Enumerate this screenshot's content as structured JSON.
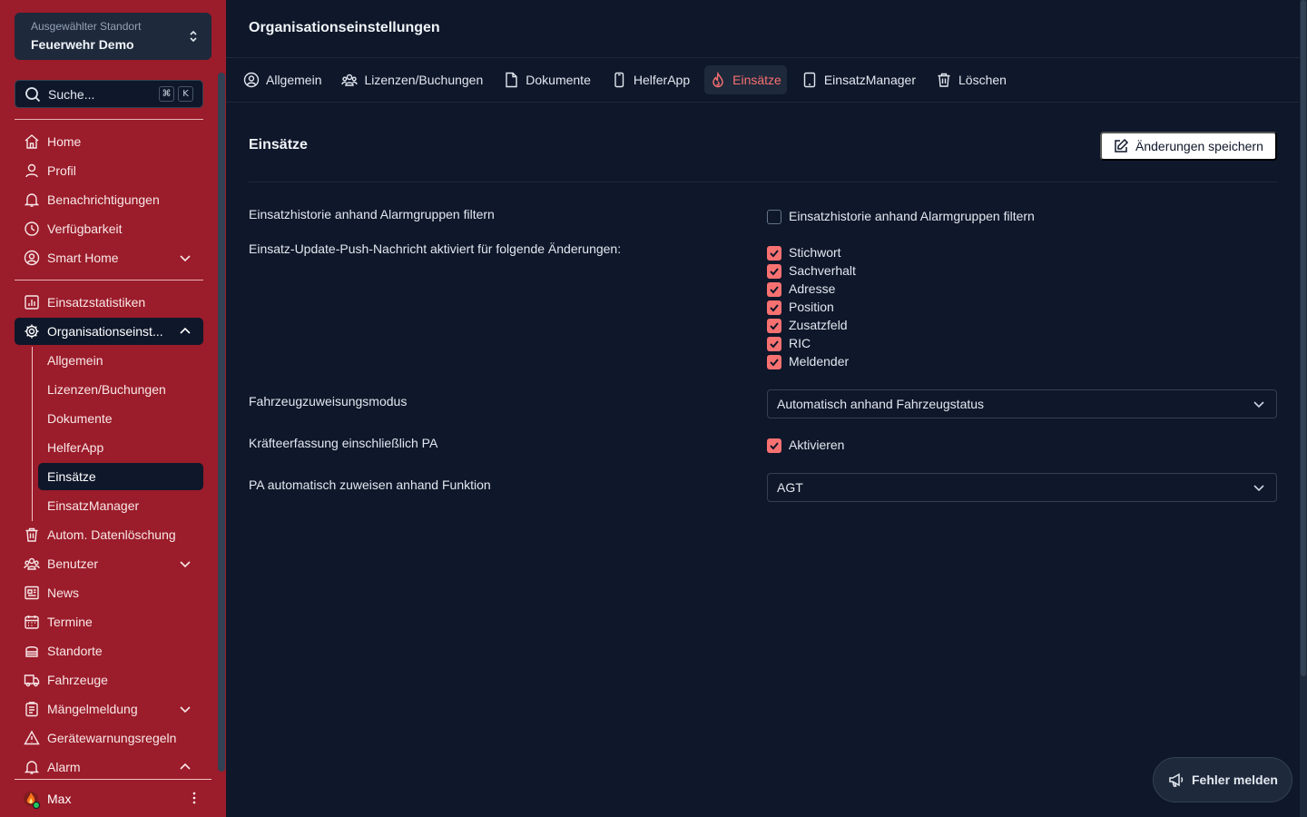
{
  "sidebar": {
    "location_label": "Ausgewählter Standort",
    "location_value": "Feuerwehr Demo",
    "search_label": "Suche...",
    "search_kbd_1": "⌘",
    "search_kbd_2": "K",
    "items": [
      {
        "label": "Home",
        "icon": "home-icon"
      },
      {
        "label": "Profil",
        "icon": "user-icon"
      },
      {
        "label": "Benachrichtigungen",
        "icon": "bell-icon"
      },
      {
        "label": "Verfügbarkeit",
        "icon": "clock-icon"
      },
      {
        "label": "Smart Home",
        "icon": "user-circle-icon"
      },
      {
        "label": "Einsatzstatistiken",
        "icon": "chart-icon"
      },
      {
        "label": "Organisationseinst...",
        "icon": "gear-icon"
      },
      {
        "label": "Autom. Datenlöschung",
        "icon": "trash-icon"
      },
      {
        "label": "Benutzer",
        "icon": "users-icon"
      },
      {
        "label": "News",
        "icon": "newspaper-icon"
      },
      {
        "label": "Termine",
        "icon": "calendar-icon"
      },
      {
        "label": "Standorte",
        "icon": "building-icon"
      },
      {
        "label": "Fahrzeuge",
        "icon": "truck-icon"
      },
      {
        "label": "Mängelmeldung",
        "icon": "clipboard-icon"
      },
      {
        "label": "Gerätewarnungsregeln",
        "icon": "warning-icon"
      },
      {
        "label": "Alarm",
        "icon": "bell-icon"
      }
    ],
    "sub_items": [
      {
        "label": "Allgemein"
      },
      {
        "label": "Lizenzen/Buchungen"
      },
      {
        "label": "Dokumente"
      },
      {
        "label": "HelferApp"
      },
      {
        "label": "Einsätze"
      },
      {
        "label": "EinsatzManager"
      }
    ],
    "user_name": "Max"
  },
  "header": {
    "title": "Organisationseinstellungen"
  },
  "tabs": [
    {
      "label": "Allgemein",
      "icon": "user-circle-icon"
    },
    {
      "label": "Lizenzen/Buchungen",
      "icon": "users-icon"
    },
    {
      "label": "Dokumente",
      "icon": "document-icon"
    },
    {
      "label": "HelferApp",
      "icon": "phone-icon"
    },
    {
      "label": "Einsätze",
      "icon": "fire-icon"
    },
    {
      "label": "EinsatzManager",
      "icon": "tablet-icon"
    },
    {
      "label": "Löschen",
      "icon": "trash-icon"
    }
  ],
  "section": {
    "title": "Einsätze",
    "save_label": "Änderungen speichern"
  },
  "settings": {
    "filter_label": "Einsatzhistorie anhand Alarmgruppen filtern",
    "filter_checkbox_label": "Einsatzhistorie anhand Alarmgruppen filtern",
    "filter_checked": false,
    "push_label": "Einsatz-Update-Push-Nachricht aktiviert für folgende Änderungen:",
    "push_options": [
      {
        "label": "Stichwort",
        "checked": true
      },
      {
        "label": "Sachverhalt",
        "checked": true
      },
      {
        "label": "Adresse",
        "checked": true
      },
      {
        "label": "Position",
        "checked": true
      },
      {
        "label": "Zusatzfeld",
        "checked": true
      },
      {
        "label": "RIC",
        "checked": true
      },
      {
        "label": "Meldender",
        "checked": true
      }
    ],
    "vehicle_label": "Fahrzeugzuweisungsmodus",
    "vehicle_value": "Automatisch anhand Fahrzeugstatus",
    "pa_label": "Kräfteerfassung einschließlich PA",
    "pa_checkbox_label": "Aktivieren",
    "pa_checked": true,
    "pa_auto_label": "PA automatisch zuweisen anhand Funktion",
    "pa_auto_value": "AGT"
  },
  "report_button": "Fehler melden",
  "colors": {
    "sidebar": "#9b1c2a",
    "background": "#0f172a",
    "accent": "#f87171"
  }
}
